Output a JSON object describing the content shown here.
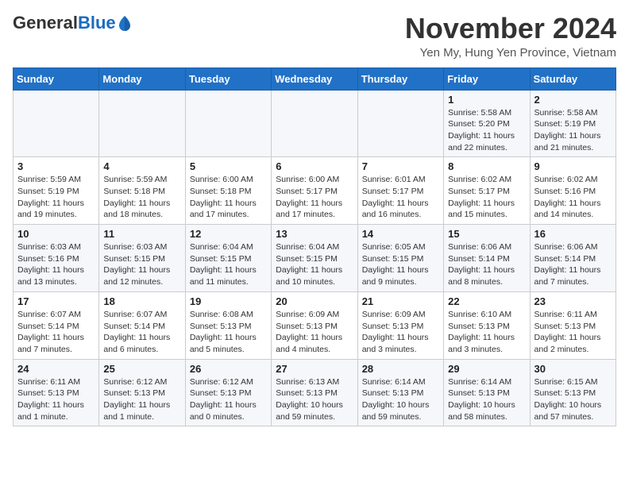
{
  "header": {
    "logo_general": "General",
    "logo_blue": "Blue",
    "title": "November 2024",
    "location": "Yen My, Hung Yen Province, Vietnam"
  },
  "calendar": {
    "weekdays": [
      "Sunday",
      "Monday",
      "Tuesday",
      "Wednesday",
      "Thursday",
      "Friday",
      "Saturday"
    ],
    "weeks": [
      [
        {
          "day": "",
          "sunrise": "",
          "sunset": "",
          "daylight": ""
        },
        {
          "day": "",
          "sunrise": "",
          "sunset": "",
          "daylight": ""
        },
        {
          "day": "",
          "sunrise": "",
          "sunset": "",
          "daylight": ""
        },
        {
          "day": "",
          "sunrise": "",
          "sunset": "",
          "daylight": ""
        },
        {
          "day": "",
          "sunrise": "",
          "sunset": "",
          "daylight": ""
        },
        {
          "day": "1",
          "sunrise": "Sunrise: 5:58 AM",
          "sunset": "Sunset: 5:20 PM",
          "daylight": "Daylight: 11 hours and 22 minutes."
        },
        {
          "day": "2",
          "sunrise": "Sunrise: 5:58 AM",
          "sunset": "Sunset: 5:19 PM",
          "daylight": "Daylight: 11 hours and 21 minutes."
        }
      ],
      [
        {
          "day": "3",
          "sunrise": "Sunrise: 5:59 AM",
          "sunset": "Sunset: 5:19 PM",
          "daylight": "Daylight: 11 hours and 19 minutes."
        },
        {
          "day": "4",
          "sunrise": "Sunrise: 5:59 AM",
          "sunset": "Sunset: 5:18 PM",
          "daylight": "Daylight: 11 hours and 18 minutes."
        },
        {
          "day": "5",
          "sunrise": "Sunrise: 6:00 AM",
          "sunset": "Sunset: 5:18 PM",
          "daylight": "Daylight: 11 hours and 17 minutes."
        },
        {
          "day": "6",
          "sunrise": "Sunrise: 6:00 AM",
          "sunset": "Sunset: 5:17 PM",
          "daylight": "Daylight: 11 hours and 17 minutes."
        },
        {
          "day": "7",
          "sunrise": "Sunrise: 6:01 AM",
          "sunset": "Sunset: 5:17 PM",
          "daylight": "Daylight: 11 hours and 16 minutes."
        },
        {
          "day": "8",
          "sunrise": "Sunrise: 6:02 AM",
          "sunset": "Sunset: 5:17 PM",
          "daylight": "Daylight: 11 hours and 15 minutes."
        },
        {
          "day": "9",
          "sunrise": "Sunrise: 6:02 AM",
          "sunset": "Sunset: 5:16 PM",
          "daylight": "Daylight: 11 hours and 14 minutes."
        }
      ],
      [
        {
          "day": "10",
          "sunrise": "Sunrise: 6:03 AM",
          "sunset": "Sunset: 5:16 PM",
          "daylight": "Daylight: 11 hours and 13 minutes."
        },
        {
          "day": "11",
          "sunrise": "Sunrise: 6:03 AM",
          "sunset": "Sunset: 5:15 PM",
          "daylight": "Daylight: 11 hours and 12 minutes."
        },
        {
          "day": "12",
          "sunrise": "Sunrise: 6:04 AM",
          "sunset": "Sunset: 5:15 PM",
          "daylight": "Daylight: 11 hours and 11 minutes."
        },
        {
          "day": "13",
          "sunrise": "Sunrise: 6:04 AM",
          "sunset": "Sunset: 5:15 PM",
          "daylight": "Daylight: 11 hours and 10 minutes."
        },
        {
          "day": "14",
          "sunrise": "Sunrise: 6:05 AM",
          "sunset": "Sunset: 5:15 PM",
          "daylight": "Daylight: 11 hours and 9 minutes."
        },
        {
          "day": "15",
          "sunrise": "Sunrise: 6:06 AM",
          "sunset": "Sunset: 5:14 PM",
          "daylight": "Daylight: 11 hours and 8 minutes."
        },
        {
          "day": "16",
          "sunrise": "Sunrise: 6:06 AM",
          "sunset": "Sunset: 5:14 PM",
          "daylight": "Daylight: 11 hours and 7 minutes."
        }
      ],
      [
        {
          "day": "17",
          "sunrise": "Sunrise: 6:07 AM",
          "sunset": "Sunset: 5:14 PM",
          "daylight": "Daylight: 11 hours and 7 minutes."
        },
        {
          "day": "18",
          "sunrise": "Sunrise: 6:07 AM",
          "sunset": "Sunset: 5:14 PM",
          "daylight": "Daylight: 11 hours and 6 minutes."
        },
        {
          "day": "19",
          "sunrise": "Sunrise: 6:08 AM",
          "sunset": "Sunset: 5:13 PM",
          "daylight": "Daylight: 11 hours and 5 minutes."
        },
        {
          "day": "20",
          "sunrise": "Sunrise: 6:09 AM",
          "sunset": "Sunset: 5:13 PM",
          "daylight": "Daylight: 11 hours and 4 minutes."
        },
        {
          "day": "21",
          "sunrise": "Sunrise: 6:09 AM",
          "sunset": "Sunset: 5:13 PM",
          "daylight": "Daylight: 11 hours and 3 minutes."
        },
        {
          "day": "22",
          "sunrise": "Sunrise: 6:10 AM",
          "sunset": "Sunset: 5:13 PM",
          "daylight": "Daylight: 11 hours and 3 minutes."
        },
        {
          "day": "23",
          "sunrise": "Sunrise: 6:11 AM",
          "sunset": "Sunset: 5:13 PM",
          "daylight": "Daylight: 11 hours and 2 minutes."
        }
      ],
      [
        {
          "day": "24",
          "sunrise": "Sunrise: 6:11 AM",
          "sunset": "Sunset: 5:13 PM",
          "daylight": "Daylight: 11 hours and 1 minute."
        },
        {
          "day": "25",
          "sunrise": "Sunrise: 6:12 AM",
          "sunset": "Sunset: 5:13 PM",
          "daylight": "Daylight: 11 hours and 1 minute."
        },
        {
          "day": "26",
          "sunrise": "Sunrise: 6:12 AM",
          "sunset": "Sunset: 5:13 PM",
          "daylight": "Daylight: 11 hours and 0 minutes."
        },
        {
          "day": "27",
          "sunrise": "Sunrise: 6:13 AM",
          "sunset": "Sunset: 5:13 PM",
          "daylight": "Daylight: 10 hours and 59 minutes."
        },
        {
          "day": "28",
          "sunrise": "Sunrise: 6:14 AM",
          "sunset": "Sunset: 5:13 PM",
          "daylight": "Daylight: 10 hours and 59 minutes."
        },
        {
          "day": "29",
          "sunrise": "Sunrise: 6:14 AM",
          "sunset": "Sunset: 5:13 PM",
          "daylight": "Daylight: 10 hours and 58 minutes."
        },
        {
          "day": "30",
          "sunrise": "Sunrise: 6:15 AM",
          "sunset": "Sunset: 5:13 PM",
          "daylight": "Daylight: 10 hours and 57 minutes."
        }
      ]
    ]
  }
}
